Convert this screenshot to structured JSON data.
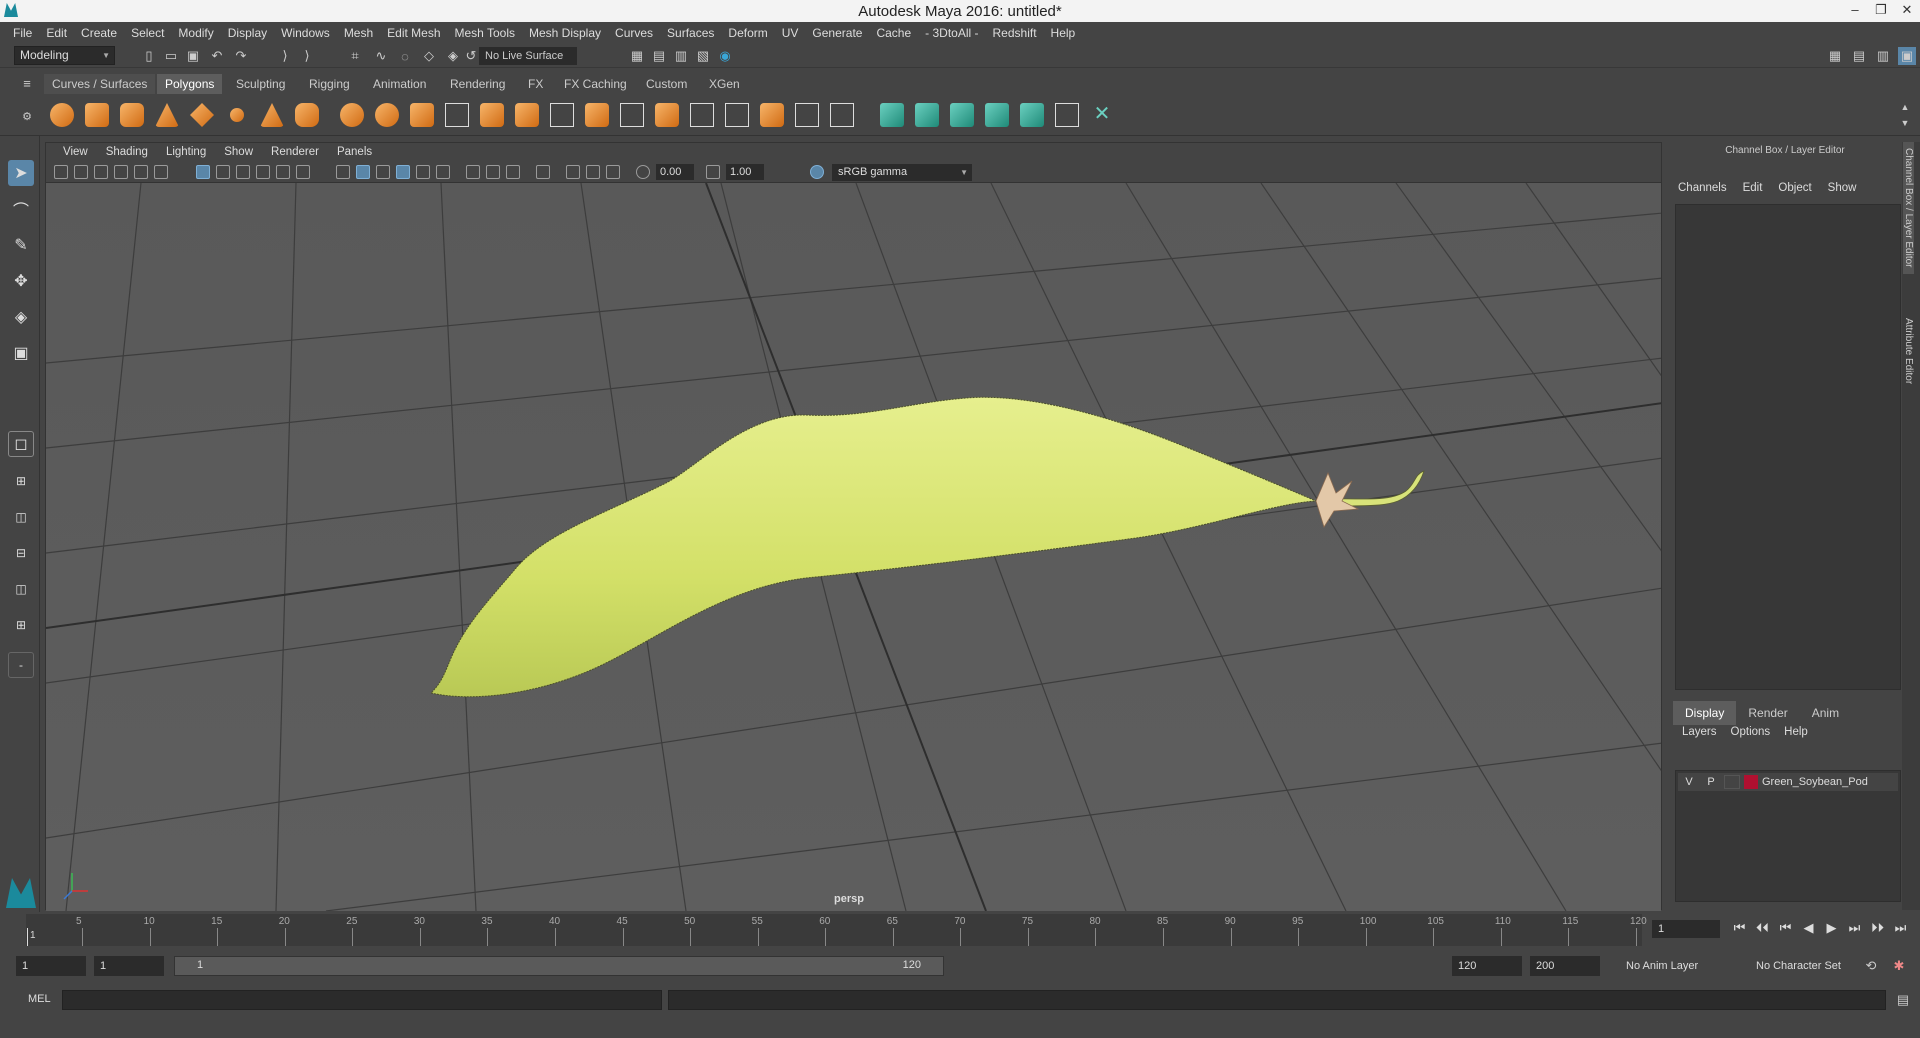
{
  "window": {
    "title": "Autodesk Maya 2016: untitled*",
    "controls": [
      "–",
      "❐",
      "✕"
    ]
  },
  "menubar": [
    "File",
    "Edit",
    "Create",
    "Select",
    "Modify",
    "Display",
    "Windows",
    "Mesh",
    "Edit Mesh",
    "Mesh Tools",
    "Mesh Display",
    "Curves",
    "Surfaces",
    "Deform",
    "UV",
    "Generate",
    "Cache",
    "- 3DtoAll -",
    "Redshift",
    "Help"
  ],
  "statusline": {
    "mode": "Modeling",
    "live_surface": "No Live Surface"
  },
  "shelf": {
    "tabs": [
      "Curves / Surfaces",
      "Polygons",
      "Sculpting",
      "Rigging",
      "Animation",
      "Rendering",
      "FX",
      "FX Caching",
      "Custom",
      "XGen"
    ],
    "active_tab": "Polygons"
  },
  "viewport": {
    "menu": [
      "View",
      "Shading",
      "Lighting",
      "Show",
      "Renderer",
      "Panels"
    ],
    "exposure": "0.00",
    "gamma_value": "1.00",
    "color_space": "sRGB gamma",
    "camera_label": "persp",
    "object_color": "#d4e36a"
  },
  "channel_box": {
    "title": "Channel Box / Layer Editor",
    "menu": [
      "Channels",
      "Edit",
      "Object",
      "Show"
    ],
    "tabs": [
      "Display",
      "Render",
      "Anim"
    ],
    "layer_menu": [
      "Layers",
      "Options",
      "Help"
    ],
    "layer": {
      "visible": "V",
      "playback": "P",
      "name": "Green_Soybean_Pod",
      "color": "#b01030"
    },
    "side_tabs": [
      "Channel Box / Layer Editor",
      "Attribute Editor"
    ]
  },
  "timeline": {
    "ticks": [
      "5",
      "10",
      "15",
      "20",
      "25",
      "30",
      "35",
      "40",
      "45",
      "50",
      "55",
      "60",
      "65",
      "70",
      "75",
      "80",
      "85",
      "90",
      "95",
      "100",
      "105",
      "110",
      "115",
      "120"
    ],
    "start_label": "1",
    "current_frame": "1",
    "playback_buttons": [
      "⏮",
      "⏴⏴",
      "⏮",
      "◀",
      "▶",
      "⏭",
      "⏵⏵",
      "⏭"
    ]
  },
  "range": {
    "start_time": "1",
    "playback_start": "1",
    "slider_start": "1",
    "slider_end": "120",
    "playback_end": "120",
    "end_time": "200",
    "anim_layer": "No Anim Layer",
    "character_set": "No Character Set"
  },
  "command_line": {
    "label": "MEL"
  }
}
